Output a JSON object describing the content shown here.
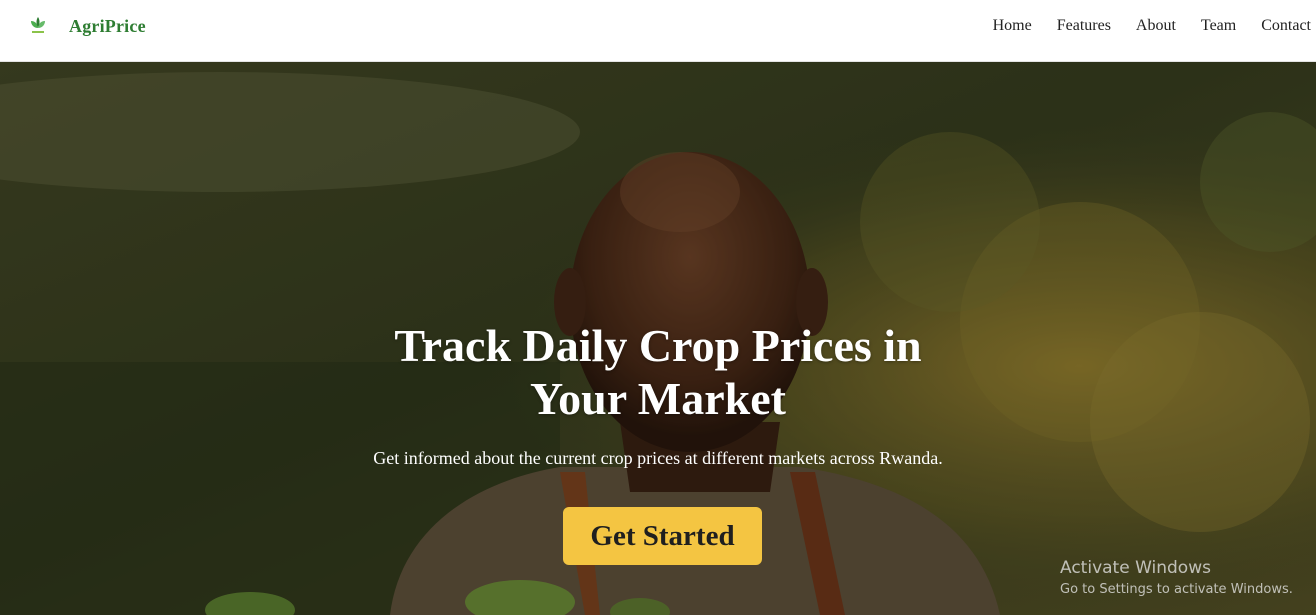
{
  "brand": {
    "name": "AgriPrice",
    "logo_icon": "leaf-logo-icon",
    "color": "#2e7d32"
  },
  "nav": {
    "items": [
      "Home",
      "Features",
      "About",
      "Team",
      "Contact"
    ]
  },
  "hero": {
    "title_line1": "Track Daily Crop Prices in",
    "title_line2": "Your Market",
    "subtitle": "Get informed about the current crop prices at different markets across Rwanda.",
    "cta_label": "Get Started",
    "cta_color": "#f4c542",
    "background": "smiling farmer in sunlit field photo"
  },
  "watermark": {
    "title": "Activate Windows",
    "subtitle": "Go to Settings to activate Windows."
  }
}
